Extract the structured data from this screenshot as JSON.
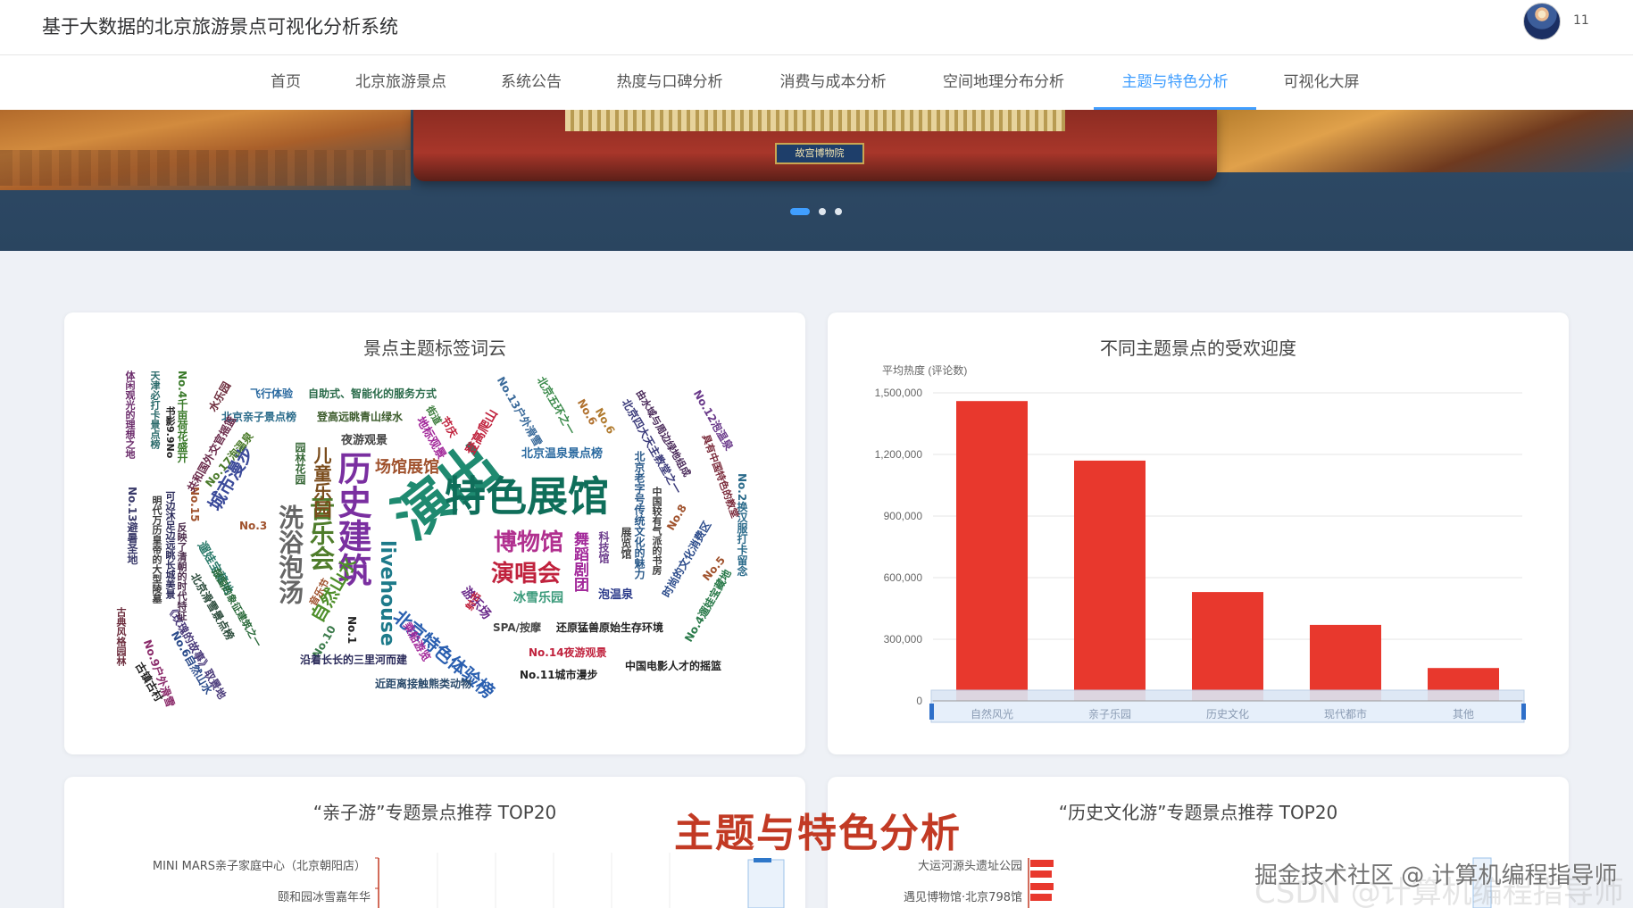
{
  "header": {
    "title": "基于大数据的北京旅游景点可视化分析系统",
    "user_name": "11"
  },
  "nav": {
    "items": [
      {
        "label": "首页"
      },
      {
        "label": "北京旅游景点"
      },
      {
        "label": "系统公告"
      },
      {
        "label": "热度与口碑分析"
      },
      {
        "label": "消费与成本分析"
      },
      {
        "label": "空间地理分布分析"
      },
      {
        "label": "主题与特色分析"
      },
      {
        "label": "可视化大屏"
      }
    ],
    "active_index": 6
  },
  "banner": {
    "plaque_text": "故宫博物院",
    "slide_count": 3,
    "active_slide": 0
  },
  "wordcloud": {
    "title": "景点主题标签词云",
    "words": [
      "演出",
      "特色展馆",
      "历史建筑",
      "博物馆",
      "演唱会",
      "音乐会",
      "洗浴泡汤",
      "livehouse",
      "北京特色体验榜",
      "儿童乐园",
      "场馆展馆",
      "城市漫步",
      "自然山水",
      "冰雪乐园",
      "舞蹈剧团",
      "泡温泉",
      "游乐场",
      "夜游观景",
      "飞行体验",
      "自助式、智能化的服务方式",
      "北京亲子景点榜",
      "登高远眺青山绿水",
      "北京温泉景点榜",
      "水乐园",
      "No.17泡温泉",
      "No.3",
      "No.1",
      "No.10",
      "No.5",
      "No.6",
      "No.8",
      "No.9户外滑雪",
      "No.6自然山水",
      "No.13户外滑雪",
      "No.12泡温泉",
      "No.2换汉服打卡留念",
      "No.4遛娃宝藏地",
      "No.14夜游观景",
      "No.11城市漫步",
      "No.13避暑圣地",
      "No.4千亩荷花盛开",
      "No.15",
      "SPA/按摩",
      "还原猛兽原始生存环境",
      "中国电影人才的摇篮",
      "近距离接触熊类动物",
      "沿着长长的三里河而建",
      "古镇古村",
      "古典风格园林",
      "地标观景",
      "登高爬山",
      "北京五环之一",
      "书影9.9No",
      "No.6",
      "共和国外交官摇篮",
      "遛娃宝藏地",
      "北京滑雪景点榜",
      "《玫瑰的故事》取景地",
      "音乐节",
      "射击",
      "乘船游览",
      "园林花园",
      "科技馆",
      "展览馆",
      "节庆",
      "北京四大天主教堂之一",
      "天津必打卡景点榜",
      "体闲观光的理想之地",
      "明代万历皇帝的大型陵墓",
      "可边沐足边远眺长城美景",
      "反映了清朝的时代特征",
      "北京老字号传统文化的魅力",
      "由水域与周边绿地组成",
      "具有中国特色的教堂",
      "中国较有气派的书房",
      "时尚的文化消费区",
      "报国的象征建筑之一",
      "街道"
    ]
  },
  "popularity_chart": {
    "title": "不同主题景点的受欢迎度",
    "chart_data": {
      "type": "bar",
      "categories": [
        "自然风光",
        "亲子乐园",
        "历史文化",
        "现代都市",
        "其他"
      ],
      "values": [
        1460000,
        1170000,
        530000,
        370000,
        160000
      ],
      "ylabel": "平均热度 (评论数)",
      "xlabel": "",
      "ylim": [
        0,
        1500000
      ],
      "yticks": [
        "0",
        "300,000",
        "600,000",
        "900,000",
        "1,200,000",
        "1,500,000"
      ],
      "grid": true,
      "bar_color": "#e8382d",
      "datazoom": true
    }
  },
  "family_top20": {
    "title": "“亲子游”专题景点推荐 TOP20",
    "visible_items": [
      "MINI MARS亲子家庭中心（北京朝阳店）",
      "颐和园冰雪嘉年华"
    ]
  },
  "history_top20": {
    "title": "“历史文化游”专题景点推荐 TOP20",
    "visible_items": [
      "大运河源头遗址公园",
      "遇见博物馆·北京798馆"
    ]
  },
  "overlay": {
    "section_title": "主题与特色分析",
    "source_watermark": "掘金技术社区 @ 计算机编程指导师",
    "ghost_watermark": "CSDN @计算机编程指导师"
  },
  "colors": {
    "accent": "#409eff",
    "bar": "#e8382d",
    "watermark": "#c23a24"
  }
}
